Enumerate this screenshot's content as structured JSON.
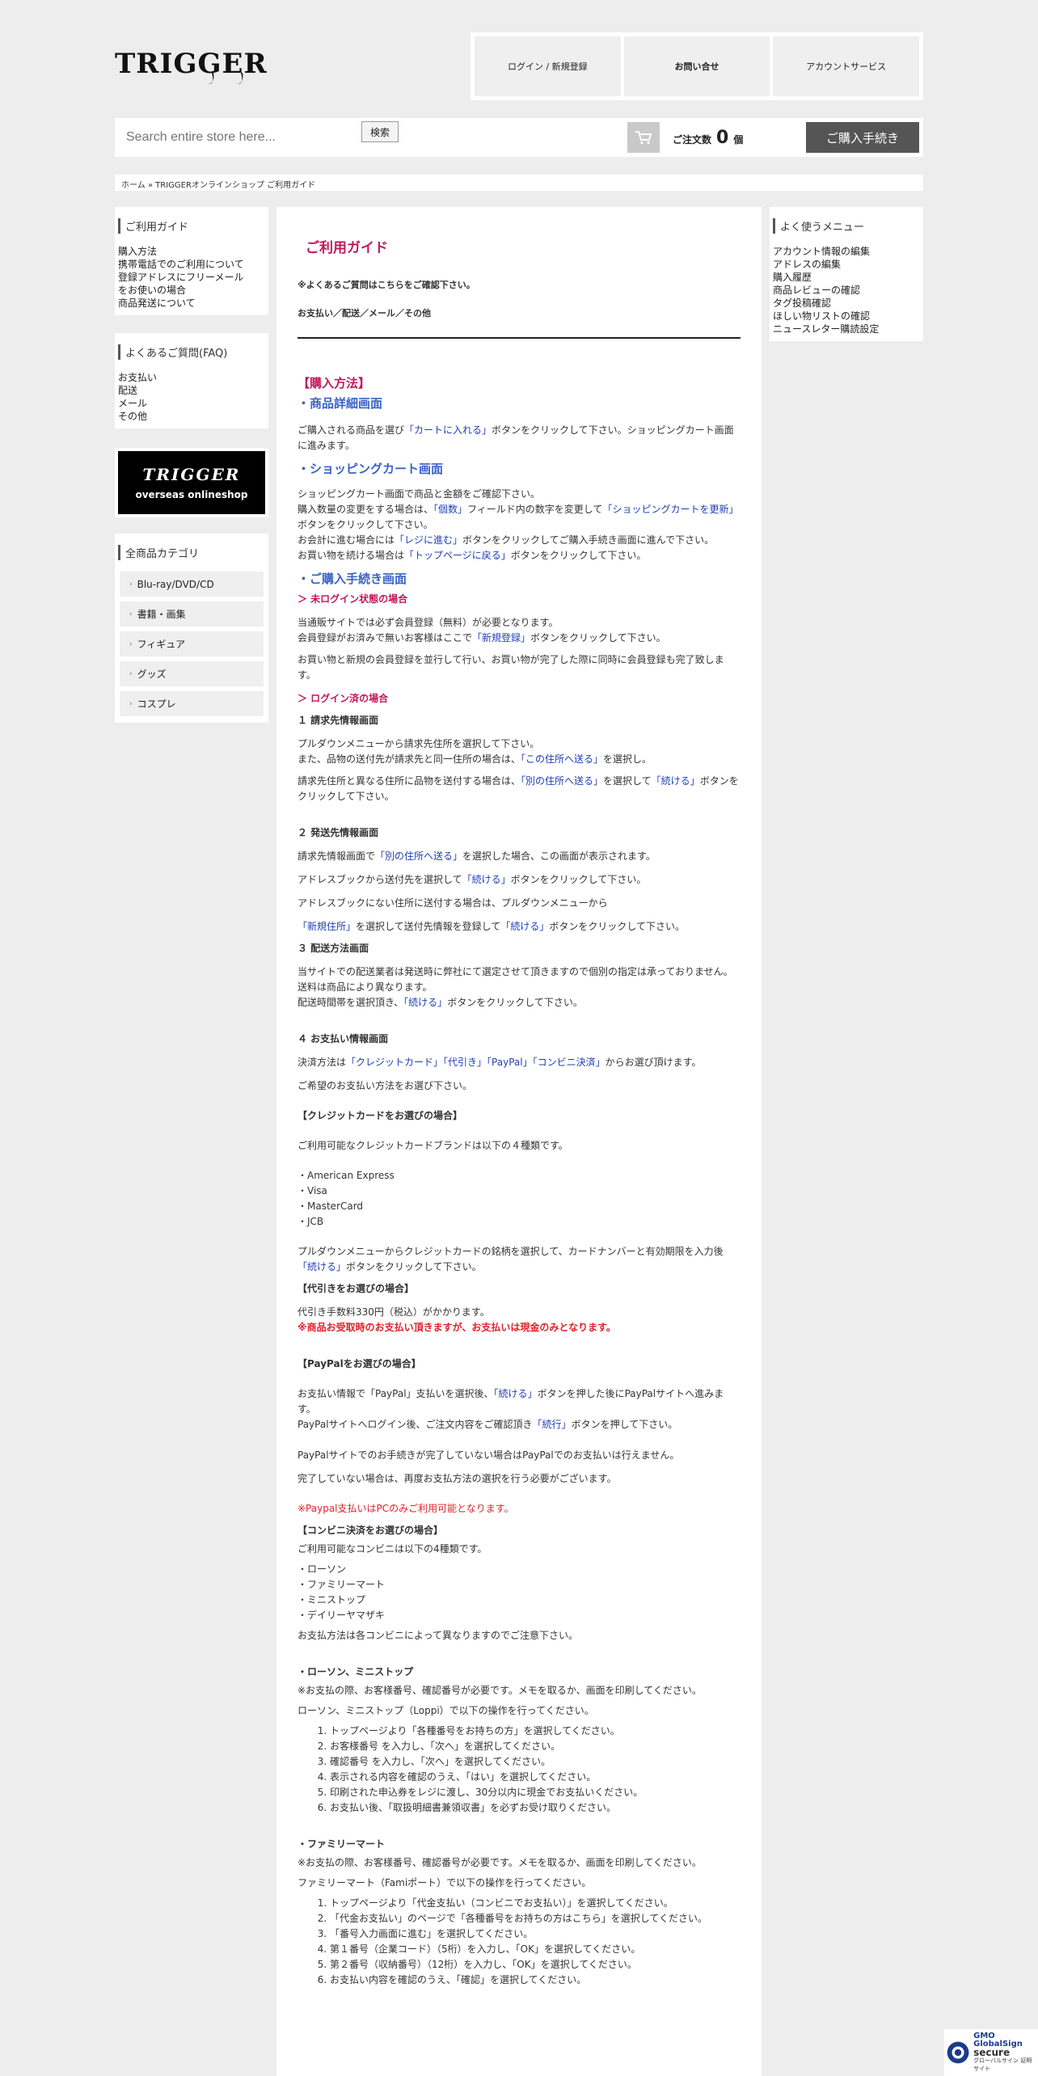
{
  "header": {
    "logo_text": "TRIGGER",
    "nav": [
      "ログイン / 新規登録",
      "お問い合せ",
      "アカウントサービス"
    ]
  },
  "search": {
    "placeholder": "Search entire store here...",
    "button": "検索"
  },
  "cart": {
    "label": "ご注文数",
    "count": "0",
    "unit": "個",
    "checkout": "ご購入手続き"
  },
  "breadcrumb": "ホーム » TRIGGERオンラインショップ ご利用ガイド",
  "left": {
    "guide_title": "ご利用ガイド",
    "guide_links": [
      "購入方法",
      "携帯電話でのご利用について",
      "登録アドレスにフリーメール",
      "をお使いの場合",
      "商品発送について"
    ],
    "faq_title": "よくあるご質問(FAQ)",
    "faq_links": [
      "お支払い",
      "配送",
      "メール",
      "その他"
    ],
    "banner_logo": "TRIGGER",
    "banner_sub": "overseas onlineshop",
    "cat_title": "全商品カテゴリ",
    "categories": [
      "Blu-ray/DVD/CD",
      "書籍・画集",
      "フィギュア",
      "グッズ",
      "コスプレ"
    ]
  },
  "right": {
    "title": "よく使うメニュー",
    "links": [
      "アカウント情報の編集",
      "アドレスの編集",
      "購入履歴",
      "商品レビューの確認",
      "タグ投稿確認",
      "ほしい物リストの確認",
      "ニュースレター購読設定"
    ]
  },
  "main": {
    "page_title": "ご利用ガイド",
    "faq_note": "※よくあるご質問はこちらをご確認下さい。",
    "faq_cats": "お支払い／配送／メール／その他",
    "s1": "【購入方法】",
    "s1a": "・商品詳細画面",
    "p1a": "ご購入される商品を選び",
    "l_cart": "「カートに入れる」",
    "p1b": "ボタンをクリックして下さい。ショッピングカート画面に進みます。",
    "s1b": "・ショッピングカート画面",
    "p2a": "ショッピングカート画面で商品と金額をご確認下さい。",
    "p2b": "購入数量の変更をする場合は、",
    "l_qty": "「個数」",
    "p2c": "フィールド内の数字を変更して",
    "l_upd": "「ショッピングカートを更新」",
    "p2d": "ボタンをクリックして下さい。",
    "p2e": "お会計に進む場合には",
    "l_reg": "「レジに進む」",
    "p2f": "ボタンをクリックしてご購入手続き画面に進んで下さい。",
    "p2g": "お買い物を続ける場合は",
    "l_top": "「トップページに戻る」",
    "p2h": "ボタンをクリックして下さい。",
    "s1c": "・ご購入手続き画面",
    "h_nolog": "＞ 未ログイン状態の場合",
    "p3a": "当通販サイトでは必ず会員登録（無料）が必要となります。",
    "p3b": "会員登録がお済みで無いお客様はここで",
    "l_new": "「新規登録」",
    "p3c": "ボタンをクリックして下さい。",
    "p3d": "お買い物と新規の会員登録を並行して行い、お買い物が完了した際に同時に会員登録も完了致します。",
    "h_log": "＞ ログイン済の場合",
    "h_bill": "１ 請求先情報画面",
    "p4a": "プルダウンメニューから請求先住所を選択して下さい。",
    "p4b": "また、品物の送付先が請求先と同一住所の場合は、",
    "l_same": "「この住所へ送る」",
    "p4c": "を選択し。",
    "p4d": "請求先住所と異なる住所に品物を送付する場合は、",
    "l_other": "「別の住所へ送る」",
    "p4e": "を選択して",
    "l_cont": "「続ける」",
    "p4f": "ボタンをクリックして下さい。",
    "h_ship": "２ 発送先情報画面",
    "p5a": "請求先情報画面で",
    "p5b": "を選択した場合、この画面が表示されます。",
    "p5c": "アドレスブックから送付先を選択して",
    "p5d": "ボタンをクリックして下さい。",
    "p5e": "アドレスブックにない住所に送付する場合は、プルダウンメニューから",
    "l_newaddr": "「新規住所」",
    "p5f": "を選択して送付先情報を登録して",
    "h_method": "３ 配送方法画面",
    "p6a": "当サイトでの配送業者は発送時に弊社にて選定させて頂きますので個別の指定は承っておりません。",
    "p6b": "送料は商品により異なります。",
    "p6c": "配送時間帯を選択頂き、",
    "h_pay": "４ お支払い情報画面",
    "p7a": "決済方法は",
    "l_cc": "「クレジットカード」",
    "l_cod": "「代引き」",
    "l_pp": "「PayPal」",
    "l_cvs": "「コンビニ決済」",
    "p7b": "からお選び頂けます。",
    "p7c": "ご希望のお支払い方法をお選び下さい。",
    "h_cc": "【クレジットカードをお選びの場合】",
    "p8a": "ご利用可能なクレジットカードブランドは以下の４種類です。",
    "brands": [
      "・American Express",
      "・Visa",
      "・MasterCard",
      "・JCB"
    ],
    "p8b": "プルダウンメニューからクレジットカードの銘柄を選択して、カードナンバーと有効期限を入力後",
    "h_cod": "【代引きをお選びの場合】",
    "p9a": "代引き手数料330円（税込）がかかります。",
    "p9b": "※商品お受取時のお支払い頂きますが、お支払いは現金のみとなります。",
    "h_pp": "【PayPalをお選びの場合】",
    "p10a": "お支払い情報で「PayPal」支払いを選択後、",
    "p10b": "ボタンを押した後にPayPalサイトへ進みます。",
    "p10c": "PayPalサイトへログイン後、ご注文内容をご確認頂き",
    "l_cont2": "「続行」",
    "p10d": "ボタンを押して下さい。",
    "p10e": "PayPalサイトでのお手続きが完了していない場合はPayPalでのお支払いは行えません。",
    "p10f": "完了していない場合は、再度お支払方法の選択を行う必要がございます。",
    "p10g": "※Paypal支払いはPCのみご利用可能となります。",
    "h_cvs": "【コンビニ決済をお選びの場合】",
    "p11a": "ご利用可能なコンビニは以下の4種類です。",
    "stores": [
      "・ローソン",
      "・ファミリーマート",
      "・ミニストップ",
      "・デイリーヤマザキ"
    ],
    "p11b": "お支払方法は各コンビニによって異なりますのでご注意下さい。",
    "h_lawson": "・ローソン、ミニストップ",
    "p12a": "※お支払の際、お客様番号、確認番号が必要です。メモを取るか、画面を印刷してください。",
    "p12b": "ローソン、ミニストップ（Loppi）で以下の操作を行ってください。",
    "lawson_steps": [
      "トップページより「各種番号をお持ちの方」を選択してください。",
      "お客様番号 を入力し、「次へ」を選択してください。",
      "確認番号 を入力し、「次へ」を選択してください。",
      "表示される内容を確認のうえ、「はい」を選択してください。",
      "印刷された申込券をレジに渡し、30分以内に現金でお支払いください。",
      "お支払い後、「取扱明細書兼領収書」を必ずお受け取りください。"
    ],
    "h_fami": "・ファミリーマート",
    "p13a": "※お支払の際、お客様番号、確認番号が必要です。メモを取るか、画面を印刷してください。",
    "p13b": "ファミリーマート（Famiポート）で以下の操作を行ってください。",
    "fami_steps": [
      "トップページより「代金支払い（コンビニでお支払い）」を選択してください。",
      "「代金お支払い」のページで「各種番号をお持ちの方はこちら」を選択してください。",
      "「番号入力画面に進む」を選択してください。",
      "第１番号（企業コード）（5桁）を入力し、「OK」を選択してください。",
      "第２番号（収納番号）（12桁）を入力し、「OK」を選択してください。",
      "お支払い内容を確認のうえ、「確認」を選択してください。"
    ]
  },
  "seal": {
    "brand": "GMO",
    "line1": "GlobalSign",
    "line2": "secure",
    "caption": "グローバルサイン 証明サイト"
  }
}
